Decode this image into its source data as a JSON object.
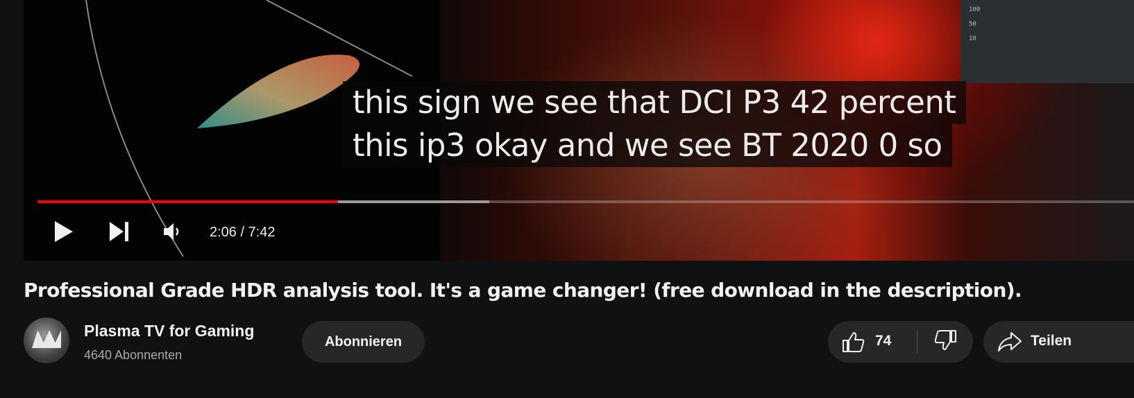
{
  "player": {
    "caption_line1": "this sign we see that DCI P3 42 percent",
    "caption_line2": "this ip3 okay and we see BT 2020 0 so",
    "time": "2:06 / 7:42",
    "progress_fraction": 0.274,
    "buffered_fraction": 0.412,
    "chart_tick_labels": [
      "100",
      "50",
      "10"
    ],
    "controls": {
      "play_icon": "play-icon",
      "next_icon": "next-icon",
      "volume_icon": "volume-icon"
    },
    "colors": {
      "played": "#ff0000",
      "buffer": "#dcdcdc"
    }
  },
  "video": {
    "title": "Professional Grade HDR analysis tool. It's a game changer! (free download in the description)."
  },
  "channel": {
    "name": "Plasma TV for Gaming",
    "subscribers": "4640 Abonnenten",
    "subscribe_label": "Abonnieren"
  },
  "actions": {
    "like_count": "74",
    "like_icon": "thumbs-up-icon",
    "dislike_icon": "thumbs-down-icon",
    "share_label": "Teilen",
    "share_icon": "share-icon"
  }
}
